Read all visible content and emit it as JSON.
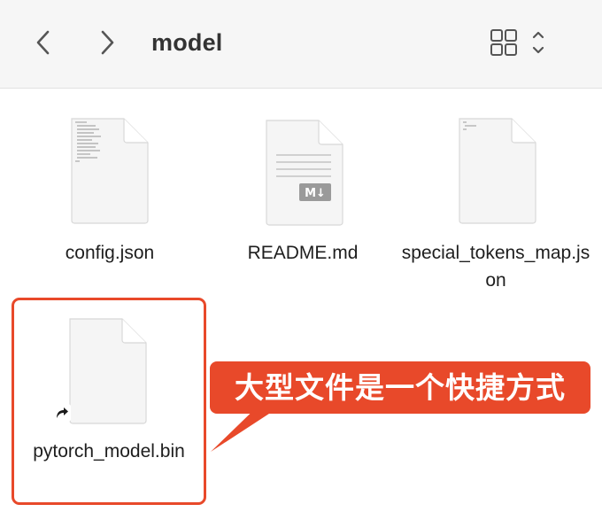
{
  "window": {
    "title": "model"
  },
  "toolbar": {
    "back_icon": "chevron-left-icon",
    "forward_icon": "chevron-right-icon",
    "view_icon": "grid-view-icon"
  },
  "files": [
    {
      "name": "config.json",
      "icon": "text-document-icon"
    },
    {
      "name": "README.md",
      "icon": "markdown-document-icon",
      "badge": "M↓"
    },
    {
      "name": "special_tokens_map.json",
      "icon": "text-document-icon"
    },
    {
      "name": "pytorch_model.bin",
      "icon": "generic-document-icon",
      "alias": true
    }
  ],
  "annotation": {
    "text": "大型文件是一个快捷方式",
    "color": "#e8492a"
  }
}
